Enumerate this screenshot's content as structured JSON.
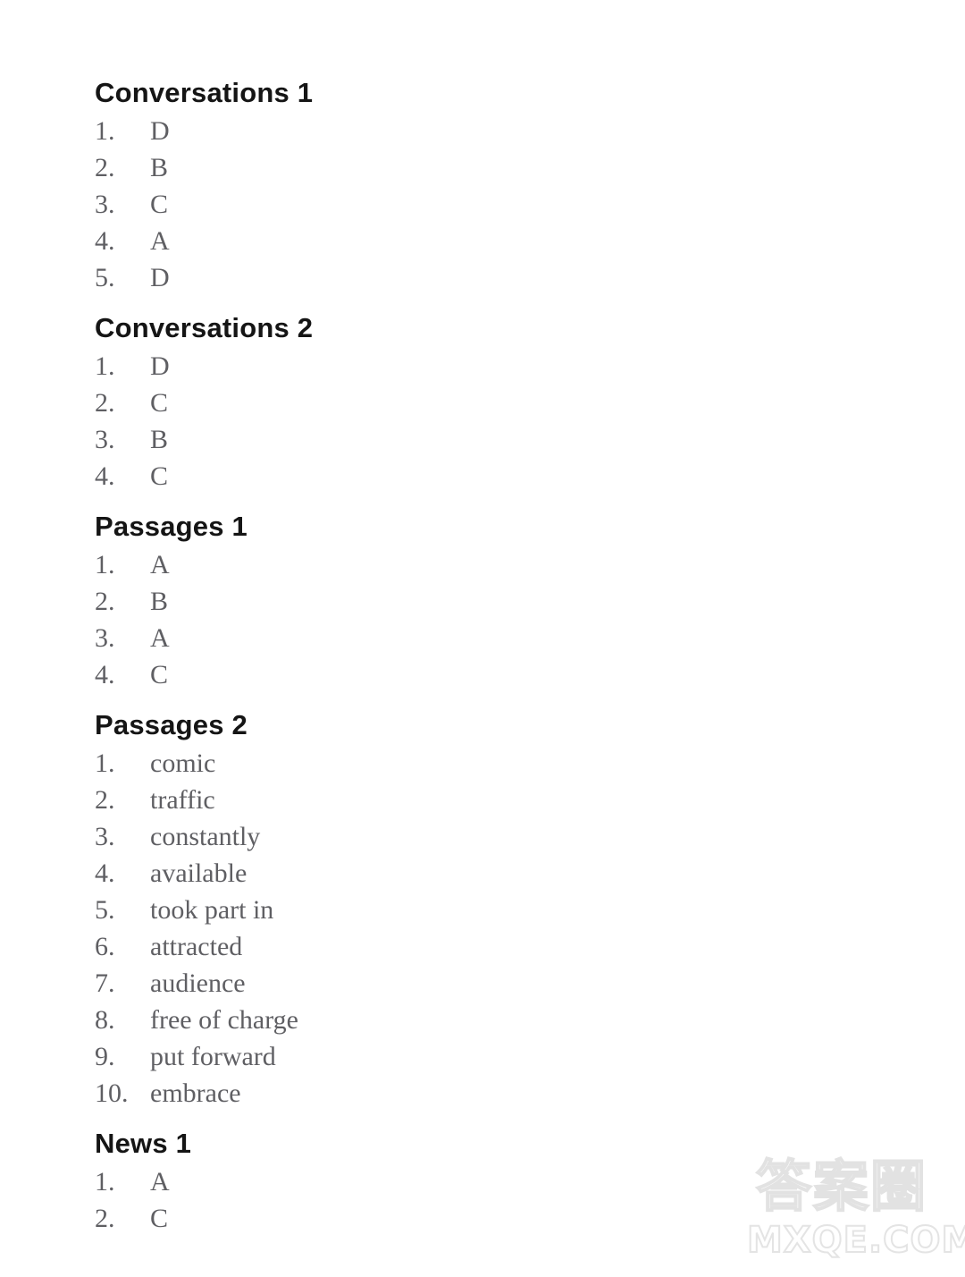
{
  "document": {
    "type": "answer-key",
    "watermark": {
      "cjk_text": "答案圈",
      "domain_text": "MXQE.COM",
      "color": "#e3e3e3"
    }
  },
  "sections": [
    {
      "heading": "Conversations 1",
      "items": [
        {
          "number": "1.",
          "answer": "D"
        },
        {
          "number": "2.",
          "answer": "B"
        },
        {
          "number": "3.",
          "answer": "C"
        },
        {
          "number": "4.",
          "answer": "A"
        },
        {
          "number": "5.",
          "answer": "D"
        }
      ]
    },
    {
      "heading": "Conversations 2",
      "items": [
        {
          "number": "1.",
          "answer": "D"
        },
        {
          "number": "2.",
          "answer": "C"
        },
        {
          "number": "3.",
          "answer": "B"
        },
        {
          "number": "4.",
          "answer": "C"
        }
      ]
    },
    {
      "heading": "Passages 1",
      "items": [
        {
          "number": "1.",
          "answer": "A"
        },
        {
          "number": "2.",
          "answer": "B"
        },
        {
          "number": "3.",
          "answer": "A"
        },
        {
          "number": "4.",
          "answer": "C"
        }
      ]
    },
    {
      "heading": "Passages 2",
      "items": [
        {
          "number": "1.",
          "answer": "comic"
        },
        {
          "number": "2.",
          "answer": "traffic"
        },
        {
          "number": "3.",
          "answer": "constantly"
        },
        {
          "number": "4.",
          "answer": "available"
        },
        {
          "number": "5.",
          "answer": "took part in"
        },
        {
          "number": "6.",
          "answer": "attracted"
        },
        {
          "number": "7.",
          "answer": "audience"
        },
        {
          "number": "8.",
          "answer": "free of charge"
        },
        {
          "number": "9.",
          "answer": "put forward"
        },
        {
          "number": "10.",
          "answer": "embrace"
        }
      ]
    },
    {
      "heading": "News 1",
      "items": [
        {
          "number": "1.",
          "answer": "A"
        },
        {
          "number": "2.",
          "answer": "C"
        }
      ]
    }
  ]
}
